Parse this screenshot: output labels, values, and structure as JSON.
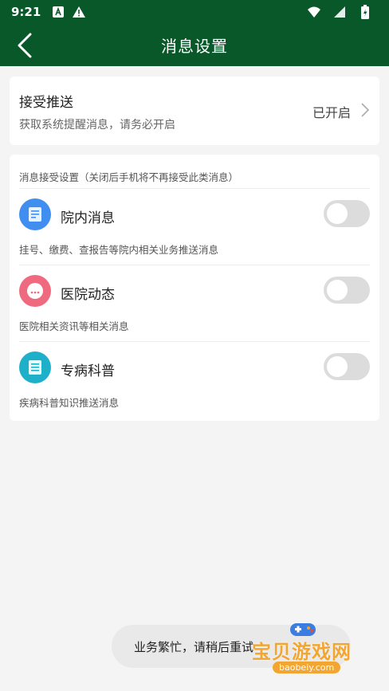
{
  "status_bar": {
    "time": "9:21"
  },
  "app_bar": {
    "title": "消息设置"
  },
  "push_card": {
    "title": "接受推送",
    "subtitle": "获取系统提醒消息，请务必开启",
    "status": "已开启"
  },
  "settings": {
    "header": "消息接受设置（关闭后手机将不再接受此类消息）",
    "items": [
      {
        "name": "院内消息",
        "desc": "挂号、缴费、查报告等院内相关业务推送消息",
        "enabled": false,
        "icon": "document-icon",
        "color": "#3f8ef0"
      },
      {
        "name": "医院动态",
        "desc": "医院相关资讯等相关消息",
        "enabled": false,
        "icon": "chat-bubble-icon",
        "color": "#f06a7f"
      },
      {
        "name": "专病科普",
        "desc": "疾病科普知识推送消息",
        "enabled": false,
        "icon": "article-icon",
        "color": "#1fb0c9"
      }
    ]
  },
  "toast": {
    "message": "业务繁忙，请稍后重试"
  },
  "watermark": {
    "text": "宝贝游戏网",
    "url": "baobeiy.com"
  },
  "colors": {
    "primary": "#08582a",
    "toggle_off": "#dcdcdc"
  }
}
